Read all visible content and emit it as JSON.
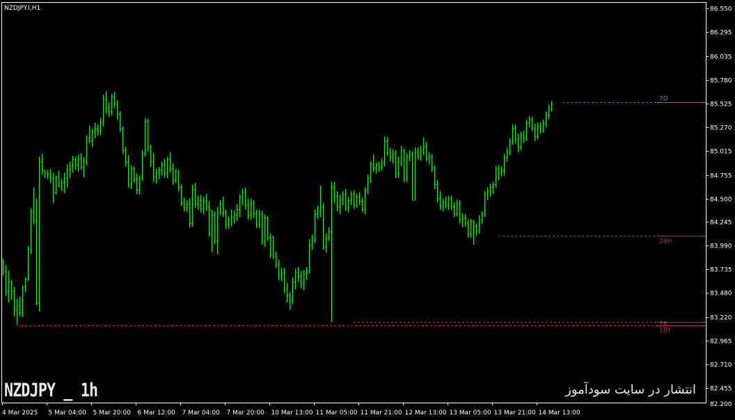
{
  "symbol_label": "NZDJPY.I,H1",
  "watermark": {
    "left": "NZDJPY _ 1h",
    "right": "انتشار در سایت سودآموز"
  },
  "colors": {
    "background": "#000000",
    "candle": "#00ff00",
    "frame": "#ffffff",
    "level_blue": "#4a7fd4",
    "level_red": "#c0303a"
  },
  "chart_data": {
    "type": "candlestick",
    "title": "NZDJPY.I,H1",
    "ylim": [
      82.297,
      86.613
    ],
    "y_ticks": [
      86.55,
      86.295,
      86.035,
      85.78,
      85.525,
      85.27,
      85.015,
      84.755,
      84.5,
      84.245,
      83.99,
      83.735,
      83.48,
      83.22,
      82.965,
      82.71,
      82.455,
      82.2
    ],
    "y_tick_labels": [
      "86.550",
      "86.295",
      "86.035",
      "85.780",
      "85.525",
      "85.270",
      "85.015",
      "84.755",
      "84.500",
      "84.245",
      "83.990",
      "83.735",
      "83.480",
      "83.220",
      "82.965",
      "82.710",
      "82.455",
      "82.200"
    ],
    "x_tick_labels": [
      "4 Mar 2025",
      "5 Mar 04:00",
      "5 Mar 20:00",
      "6 Mar 12:00",
      "7 Mar 04:00",
      "7 Mar 20:00",
      "10 Mar 13:00",
      "11 Mar 05:00",
      "11 Mar 21:00",
      "12 Mar 13:00",
      "13 Mar 05:00",
      "13 Mar 21:00",
      "14 Mar 13:00"
    ],
    "levels": [
      {
        "label": "7D",
        "price": 85.54,
        "color": "#4a7fd4",
        "start_bar": 201
      },
      {
        "label": "24H",
        "price": 84.1,
        "color": "#c0303a",
        "start_bar": 178
      },
      {
        "label": "7B",
        "price": 83.17,
        "color": "#c0303a",
        "start_bar": 126
      },
      {
        "label": "1BY",
        "price": 83.13,
        "color": "#c0303a",
        "start_bar": 5
      }
    ],
    "candles": [
      [
        83.81,
        83.85,
        83.67,
        83.71
      ],
      [
        83.71,
        83.78,
        83.45,
        83.5
      ],
      [
        83.5,
        83.72,
        83.38,
        83.6
      ],
      [
        83.6,
        83.62,
        83.41,
        83.5
      ],
      [
        83.5,
        83.55,
        83.23,
        83.3
      ],
      [
        83.3,
        83.42,
        83.14,
        83.34
      ],
      [
        83.34,
        83.44,
        83.23,
        83.26
      ],
      [
        83.26,
        83.56,
        83.22,
        83.55
      ],
      [
        83.55,
        83.65,
        83.49,
        83.63
      ],
      [
        83.63,
        83.99,
        83.61,
        83.95
      ],
      [
        83.95,
        84.4,
        83.9,
        84.36
      ],
      [
        84.36,
        84.62,
        84.22,
        84.26
      ],
      [
        84.26,
        84.5,
        83.35,
        83.37
      ],
      [
        83.37,
        84.95,
        83.28,
        84.9
      ],
      [
        84.9,
        84.98,
        84.76,
        84.8
      ],
      [
        84.8,
        84.81,
        84.72,
        84.78
      ],
      [
        84.78,
        84.81,
        84.71,
        84.76
      ],
      [
        84.76,
        84.82,
        84.67,
        84.72
      ],
      [
        84.72,
        84.78,
        84.45,
        84.56
      ],
      [
        84.56,
        84.75,
        84.54,
        84.73
      ],
      [
        84.73,
        84.8,
        84.62,
        84.63
      ],
      [
        84.63,
        84.71,
        84.58,
        84.67
      ],
      [
        84.67,
        84.78,
        84.56,
        84.72
      ],
      [
        84.72,
        84.87,
        84.62,
        84.81
      ],
      [
        84.81,
        84.9,
        84.72,
        84.85
      ],
      [
        84.85,
        84.96,
        84.78,
        84.92
      ],
      [
        84.92,
        84.95,
        84.81,
        84.86
      ],
      [
        84.86,
        84.97,
        84.79,
        84.93
      ],
      [
        84.93,
        84.99,
        84.81,
        84.84
      ],
      [
        84.84,
        84.95,
        84.73,
        84.9
      ],
      [
        84.9,
        85.18,
        84.86,
        85.15
      ],
      [
        85.15,
        85.29,
        85.1,
        85.12
      ],
      [
        85.12,
        85.25,
        85.06,
        85.22
      ],
      [
        85.22,
        85.32,
        85.15,
        85.25
      ],
      [
        85.25,
        85.3,
        85.18,
        85.23
      ],
      [
        85.23,
        85.37,
        85.19,
        85.32
      ],
      [
        85.32,
        85.62,
        85.28,
        85.57
      ],
      [
        85.57,
        85.66,
        85.42,
        85.48
      ],
      [
        85.48,
        85.54,
        85.38,
        85.44
      ],
      [
        85.44,
        85.63,
        85.4,
        85.6
      ],
      [
        85.6,
        85.65,
        85.48,
        85.52
      ],
      [
        85.52,
        85.56,
        85.35,
        85.41
      ],
      [
        85.41,
        85.44,
        85.22,
        85.25
      ],
      [
        85.25,
        85.28,
        84.98,
        85.02
      ],
      [
        85.02,
        85.06,
        84.85,
        84.89
      ],
      [
        84.89,
        84.97,
        84.62,
        84.66
      ],
      [
        84.66,
        84.86,
        84.6,
        84.82
      ],
      [
        84.82,
        84.85,
        84.67,
        84.71
      ],
      [
        84.71,
        84.77,
        84.55,
        84.59
      ],
      [
        84.59,
        84.75,
        84.54,
        84.72
      ],
      [
        84.72,
        85.02,
        84.69,
        84.99
      ],
      [
        84.99,
        85.37,
        84.95,
        85.33
      ],
      [
        85.33,
        85.36,
        85.01,
        85.05
      ],
      [
        85.05,
        85.08,
        84.84,
        84.9
      ],
      [
        84.9,
        84.99,
        84.68,
        84.73
      ],
      [
        84.73,
        84.82,
        84.66,
        84.78
      ],
      [
        84.78,
        84.84,
        84.71,
        84.8
      ],
      [
        84.8,
        84.9,
        84.75,
        84.86
      ],
      [
        84.86,
        84.93,
        84.73,
        84.77
      ],
      [
        84.77,
        84.95,
        84.72,
        84.92
      ],
      [
        84.92,
        85.0,
        84.78,
        84.82
      ],
      [
        84.82,
        84.88,
        84.65,
        84.7
      ],
      [
        84.7,
        84.82,
        84.67,
        84.79
      ],
      [
        84.79,
        84.81,
        84.58,
        84.62
      ],
      [
        84.62,
        84.65,
        84.42,
        84.45
      ],
      [
        84.45,
        84.51,
        84.36,
        84.4
      ],
      [
        84.4,
        84.48,
        84.35,
        84.44
      ],
      [
        84.44,
        84.5,
        84.19,
        84.23
      ],
      [
        84.23,
        84.65,
        84.2,
        84.6
      ],
      [
        84.6,
        84.67,
        84.4,
        84.44
      ],
      [
        84.44,
        84.53,
        84.38,
        84.48
      ],
      [
        84.48,
        84.54,
        84.35,
        84.39
      ],
      [
        84.39,
        84.52,
        84.33,
        84.47
      ],
      [
        84.47,
        84.55,
        84.37,
        84.41
      ],
      [
        84.41,
        84.47,
        84.09,
        84.12
      ],
      [
        84.12,
        84.38,
        83.92,
        84.32
      ],
      [
        84.32,
        84.36,
        84.01,
        84.04
      ],
      [
        84.04,
        84.41,
        83.9,
        84.36
      ],
      [
        84.36,
        84.48,
        84.32,
        84.44
      ],
      [
        84.44,
        84.52,
        84.3,
        84.35
      ],
      [
        84.35,
        84.38,
        84.17,
        84.22
      ],
      [
        84.22,
        84.31,
        84.17,
        84.27
      ],
      [
        84.27,
        84.38,
        84.2,
        84.3
      ],
      [
        84.3,
        84.37,
        84.23,
        84.32
      ],
      [
        84.32,
        84.44,
        84.26,
        84.38
      ],
      [
        84.38,
        84.55,
        84.3,
        84.51
      ],
      [
        84.51,
        84.61,
        84.43,
        84.57
      ],
      [
        84.57,
        84.62,
        84.38,
        84.43
      ],
      [
        84.43,
        84.5,
        84.27,
        84.31
      ],
      [
        84.31,
        84.5,
        84.27,
        84.45
      ],
      [
        84.45,
        84.48,
        84.29,
        84.34
      ],
      [
        84.34,
        84.38,
        84.18,
        84.22
      ],
      [
        84.22,
        84.38,
        84.18,
        84.33
      ],
      [
        84.33,
        84.37,
        84.0,
        84.04
      ],
      [
        84.04,
        84.33,
        83.98,
        84.29
      ],
      [
        84.29,
        84.31,
        84.04,
        84.08
      ],
      [
        84.08,
        84.12,
        83.86,
        83.9
      ],
      [
        84.08,
        84.1,
        83.85,
        83.88
      ],
      [
        83.88,
        83.93,
        83.75,
        83.79
      ],
      [
        83.79,
        83.84,
        83.62,
        83.66
      ],
      [
        83.66,
        83.75,
        83.61,
        83.7
      ],
      [
        83.7,
        83.75,
        83.48,
        83.52
      ],
      [
        83.52,
        83.59,
        83.38,
        83.45
      ],
      [
        83.45,
        83.49,
        83.3,
        83.41
      ],
      [
        83.41,
        83.65,
        83.36,
        83.6
      ],
      [
        83.6,
        83.74,
        83.52,
        83.7
      ],
      [
        83.7,
        83.76,
        83.6,
        83.66
      ],
      [
        83.66,
        83.72,
        83.53,
        83.58
      ],
      [
        83.58,
        83.73,
        83.51,
        83.69
      ],
      [
        83.69,
        83.76,
        83.62,
        83.72
      ],
      [
        83.72,
        84.06,
        83.69,
        84.0
      ],
      [
        84.0,
        84.11,
        83.95,
        84.05
      ],
      [
        84.05,
        84.38,
        84.02,
        84.33
      ],
      [
        84.33,
        84.42,
        84.28,
        84.36
      ],
      [
        84.36,
        84.64,
        84.3,
        84.41
      ],
      [
        84.41,
        84.45,
        83.95,
        83.98
      ],
      [
        83.98,
        84.12,
        83.92,
        84.07
      ],
      [
        84.07,
        84.19,
        84.04,
        84.14
      ],
      [
        84.14,
        84.68,
        83.17,
        84.62
      ],
      [
        84.62,
        84.68,
        84.45,
        84.52
      ],
      [
        84.52,
        84.58,
        84.36,
        84.41
      ],
      [
        84.41,
        84.54,
        84.33,
        84.49
      ],
      [
        84.49,
        84.58,
        84.43,
        84.55
      ],
      [
        84.55,
        84.6,
        84.37,
        84.4
      ],
      [
        84.4,
        84.52,
        84.35,
        84.48
      ],
      [
        84.48,
        84.58,
        84.43,
        84.55
      ],
      [
        84.55,
        84.59,
        84.39,
        84.43
      ],
      [
        84.43,
        84.55,
        84.4,
        84.52
      ],
      [
        84.52,
        84.57,
        84.43,
        84.47
      ],
      [
        84.47,
        84.51,
        84.35,
        84.38
      ],
      [
        84.38,
        84.62,
        84.33,
        84.59
      ],
      [
        84.59,
        84.76,
        84.55,
        84.72
      ],
      [
        84.72,
        84.9,
        84.67,
        84.87
      ],
      [
        84.87,
        84.98,
        84.79,
        84.83
      ],
      [
        84.83,
        84.89,
        84.77,
        84.86
      ],
      [
        84.86,
        84.9,
        84.79,
        84.84
      ],
      [
        84.84,
        84.93,
        84.8,
        84.88
      ],
      [
        84.88,
        85.17,
        84.85,
        85.12
      ],
      [
        85.12,
        85.16,
        84.96,
        85.0
      ],
      [
        85.0,
        85.05,
        84.9,
        84.95
      ],
      [
        84.95,
        85.03,
        84.88,
        84.98
      ],
      [
        84.98,
        85.02,
        84.72,
        84.77
      ],
      [
        84.77,
        84.95,
        84.72,
        84.89
      ],
      [
        84.89,
        85.07,
        84.85,
        85.02
      ],
      [
        85.02,
        85.04,
        84.68,
        84.72
      ],
      [
        84.72,
        84.99,
        84.68,
        84.95
      ],
      [
        84.95,
        85.02,
        84.9,
        84.98
      ],
      [
        84.98,
        85.01,
        84.48,
        84.48
      ],
      [
        84.48,
        85.05,
        84.48,
        85.0
      ],
      [
        85.0,
        85.05,
        84.92,
        84.96
      ],
      [
        84.96,
        85.07,
        84.91,
        85.02
      ],
      [
        85.02,
        85.16,
        84.97,
        85.06
      ],
      [
        85.06,
        85.11,
        84.9,
        84.93
      ],
      [
        84.93,
        85.0,
        84.87,
        84.95
      ],
      [
        84.95,
        84.98,
        84.79,
        84.83
      ],
      [
        84.83,
        84.86,
        84.6,
        84.65
      ],
      [
        84.65,
        84.7,
        84.46,
        84.5
      ],
      [
        84.5,
        84.58,
        84.38,
        84.42
      ],
      [
        84.42,
        84.5,
        84.36,
        84.46
      ],
      [
        84.46,
        84.52,
        84.39,
        84.42
      ],
      [
        84.42,
        84.53,
        84.38,
        84.49
      ],
      [
        84.49,
        84.53,
        84.38,
        84.41
      ],
      [
        84.41,
        84.46,
        84.3,
        84.34
      ],
      [
        84.34,
        84.49,
        84.31,
        84.45
      ],
      [
        84.45,
        84.48,
        84.23,
        84.27
      ],
      [
        84.27,
        84.34,
        84.19,
        84.29
      ],
      [
        84.29,
        84.33,
        84.2,
        84.24
      ],
      [
        84.24,
        84.28,
        84.08,
        84.12
      ],
      [
        84.12,
        84.28,
        84.08,
        84.25
      ],
      [
        84.25,
        84.27,
        84.0,
        84.2
      ],
      [
        84.2,
        84.23,
        84.1,
        84.15
      ],
      [
        84.15,
        84.32,
        84.12,
        84.27
      ],
      [
        84.27,
        84.36,
        84.23,
        84.33
      ],
      [
        84.33,
        84.58,
        84.3,
        84.55
      ],
      [
        84.55,
        84.62,
        84.48,
        84.58
      ],
      [
        84.58,
        84.66,
        84.52,
        84.62
      ],
      [
        84.62,
        84.68,
        84.55,
        84.65
      ],
      [
        84.65,
        84.85,
        84.62,
        84.82
      ],
      [
        84.82,
        84.86,
        84.7,
        84.78
      ],
      [
        84.78,
        84.85,
        84.74,
        84.8
      ],
      [
        84.8,
        84.98,
        84.75,
        84.94
      ],
      [
        84.94,
        85.05,
        84.9,
        85.0
      ],
      [
        85.0,
        85.15,
        84.97,
        85.11
      ],
      [
        85.11,
        85.3,
        85.08,
        85.26
      ],
      [
        85.26,
        85.3,
        85.1,
        85.14
      ],
      [
        85.14,
        85.2,
        85.0,
        85.05
      ],
      [
        85.05,
        85.22,
        85.02,
        85.18
      ],
      [
        85.18,
        85.23,
        85.1,
        85.15
      ],
      [
        85.15,
        85.35,
        85.12,
        85.32
      ],
      [
        85.32,
        85.39,
        85.27,
        85.35
      ],
      [
        85.35,
        85.38,
        85.23,
        85.26
      ],
      [
        85.26,
        85.31,
        85.12,
        85.17
      ],
      [
        85.17,
        85.32,
        85.14,
        85.28
      ],
      [
        85.28,
        85.32,
        85.2,
        85.24
      ],
      [
        85.24,
        85.35,
        85.21,
        85.31
      ],
      [
        85.31,
        85.44,
        85.27,
        85.4
      ],
      [
        85.4,
        85.51,
        85.36,
        85.47
      ],
      [
        85.47,
        85.55,
        85.44,
        85.52
      ]
    ]
  }
}
